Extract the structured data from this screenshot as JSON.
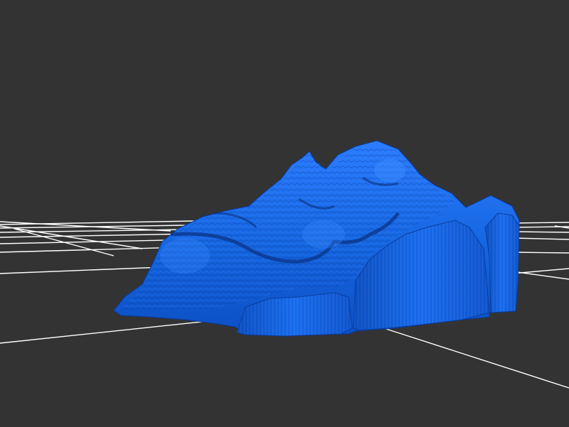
{
  "viewer": {
    "background_color": "#333333",
    "grid_color": "#ffffff",
    "model_color": "#1565e0",
    "model_shadow_color": "#0a3a99",
    "model_highlight_color": "#3a86ff",
    "grid_visible": true
  }
}
